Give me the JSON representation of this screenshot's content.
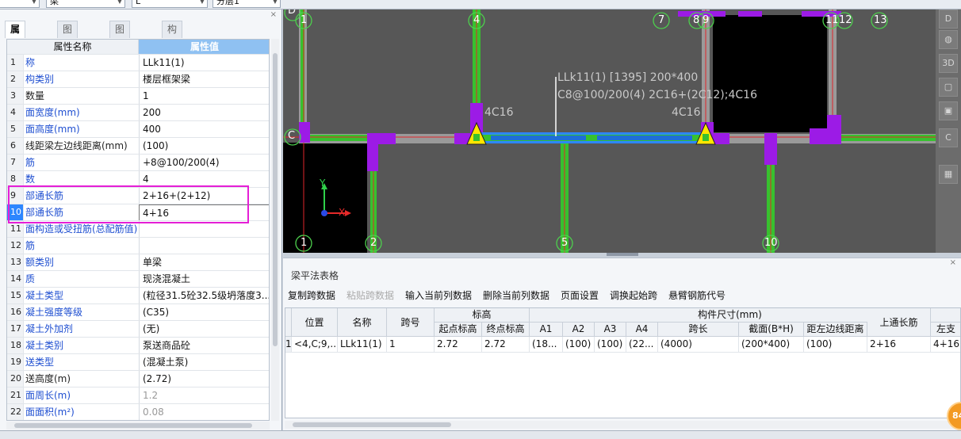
{
  "toolbar": {
    "combo1": "梁",
    "combo2": "L",
    "combo3": "分层1"
  },
  "left_panel": {
    "tabs": [
      "属性列表",
      "图纸管理",
      "图层管理",
      "构件列表"
    ],
    "active_tab": 0,
    "close_icon": "×",
    "header_name": "属性名称",
    "header_value": "属性值",
    "highlight_color": "#e51fd6",
    "rows": [
      {
        "num": "1",
        "name": "称",
        "value": "LLk11(1)",
        "blue": true
      },
      {
        "num": "2",
        "name": "构类别",
        "value": "楼层框架梁",
        "blue": true
      },
      {
        "num": "3",
        "name": "数量",
        "value": "1",
        "blue": false
      },
      {
        "num": "4",
        "name": "面宽度(mm)",
        "value": "200",
        "blue": true
      },
      {
        "num": "5",
        "name": "面高度(mm)",
        "value": "400",
        "blue": true
      },
      {
        "num": "6",
        "name": "线距梁左边线距离(mm)",
        "value": "(100)",
        "blue": false
      },
      {
        "num": "7",
        "name": "筋",
        "value": "∔8@100/200(4)",
        "blue": true
      },
      {
        "num": "8",
        "name": "数",
        "value": "4",
        "blue": true
      },
      {
        "num": "9",
        "name": "部通长筋",
        "value": "2∔16+(2∔12)",
        "blue": true
      },
      {
        "num": "10",
        "name": "部通长筋",
        "value": "4∔16",
        "blue": true
      },
      {
        "num": "11",
        "name": "面构造或受扭筋(总配筋值)",
        "value": "",
        "blue": true
      },
      {
        "num": "12",
        "name": "筋",
        "value": "",
        "blue": true
      },
      {
        "num": "13",
        "name": "额类别",
        "value": "单梁",
        "blue": true
      },
      {
        "num": "14",
        "name": "质",
        "value": "现浇混凝土",
        "blue": true
      },
      {
        "num": "15",
        "name": "凝土类型",
        "value": "(粒径31.5砼32.5级坍落度3...",
        "blue": true
      },
      {
        "num": "16",
        "name": "凝土强度等级",
        "value": "(C35)",
        "blue": true
      },
      {
        "num": "17",
        "name": "凝土外加剂",
        "value": "(无)",
        "blue": true
      },
      {
        "num": "18",
        "name": "凝土类别",
        "value": "泵送商品砼",
        "blue": true
      },
      {
        "num": "19",
        "name": "送类型",
        "value": "(混凝土泵)",
        "blue": true
      },
      {
        "num": "20",
        "name": "送高度(m)",
        "value": "(2.72)",
        "blue": false
      },
      {
        "num": "21",
        "name": "面周长(m)",
        "value": "1.2",
        "blue": true,
        "gray": true
      },
      {
        "num": "22",
        "name": "面面积(m²)",
        "value": "0.08",
        "blue": true,
        "gray": true
      }
    ]
  },
  "viewport": {
    "axis_labels_top": [
      "1",
      "4",
      "7",
      "8",
      "9",
      "11",
      "12",
      "13"
    ],
    "axis_labels_bottom": [
      "1",
      "2",
      "5",
      "10"
    ],
    "axis_labels_left": [
      "D",
      "C"
    ],
    "annotation_line1": "LLk11(1) [1395] 200*400",
    "annotation_line2": "C8@100/200(4) 2C16+(2C12);4C16",
    "rebar_left": "4C16",
    "rebar_right": "4C16",
    "axis_x": "X",
    "axis_y": "Y",
    "right_tools": [
      "D",
      "3D",
      "C"
    ]
  },
  "bottom_panel": {
    "title": "梁平法表格",
    "close_icon": "×",
    "buttons": [
      {
        "label": "复制跨数据",
        "disabled": false
      },
      {
        "label": "粘贴跨数据",
        "disabled": true
      },
      {
        "label": "输入当前列数据",
        "disabled": false
      },
      {
        "label": "删除当前列数据",
        "disabled": false
      },
      {
        "label": "页面设置",
        "disabled": false
      },
      {
        "label": "调换起始跨",
        "disabled": false
      },
      {
        "label": "悬臂钢筋代号",
        "disabled": false
      }
    ],
    "group_headers": {
      "elevation": "标高",
      "dimensions": "构件尺寸(mm)"
    },
    "columns": [
      "位置",
      "名称",
      "跨号",
      "起点标高",
      "终点标高",
      "A1",
      "A2",
      "A3",
      "A4",
      "跨长",
      "截面(B*H)",
      "距左边线距离",
      "上通长筋",
      "左支"
    ],
    "rows": [
      {
        "num": "1",
        "cells": [
          "<4,C;9,...",
          "LLk11(1)",
          "1",
          "2.72",
          "2.72",
          "(18...",
          "(100)",
          "(100)",
          "(22...",
          "(4000)",
          "(200*400)",
          "(100)",
          "2∔16",
          "4∔16"
        ]
      }
    ]
  },
  "badge": "84"
}
